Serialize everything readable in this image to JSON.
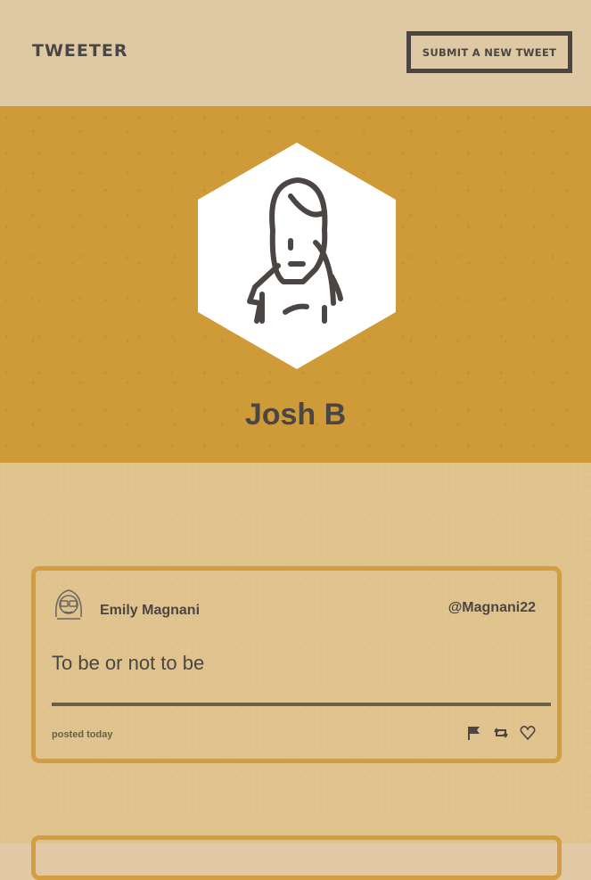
{
  "nav": {
    "brand": "TWEETER",
    "submit_label": "SUBMIT A NEW TWEET"
  },
  "profile": {
    "name": "Josh B",
    "avatar_icon": "woman-avatar-icon"
  },
  "tweets": [
    {
      "author": "Emily Magnani",
      "handle": "@Magnani22",
      "content": "To be or not to be",
      "posted": "posted today",
      "avatar_icon": "glasses-avatar-icon",
      "actions": [
        "flag-icon",
        "retweet-icon",
        "heart-icon"
      ]
    }
  ],
  "colors": {
    "nav_bg": "#dfc9a5",
    "hero_bg": "#cf9a38",
    "feed_bg": "#e0c28d",
    "tweet_border": "#d39d40",
    "text_dark": "#4b4644",
    "olive": "#676246"
  }
}
